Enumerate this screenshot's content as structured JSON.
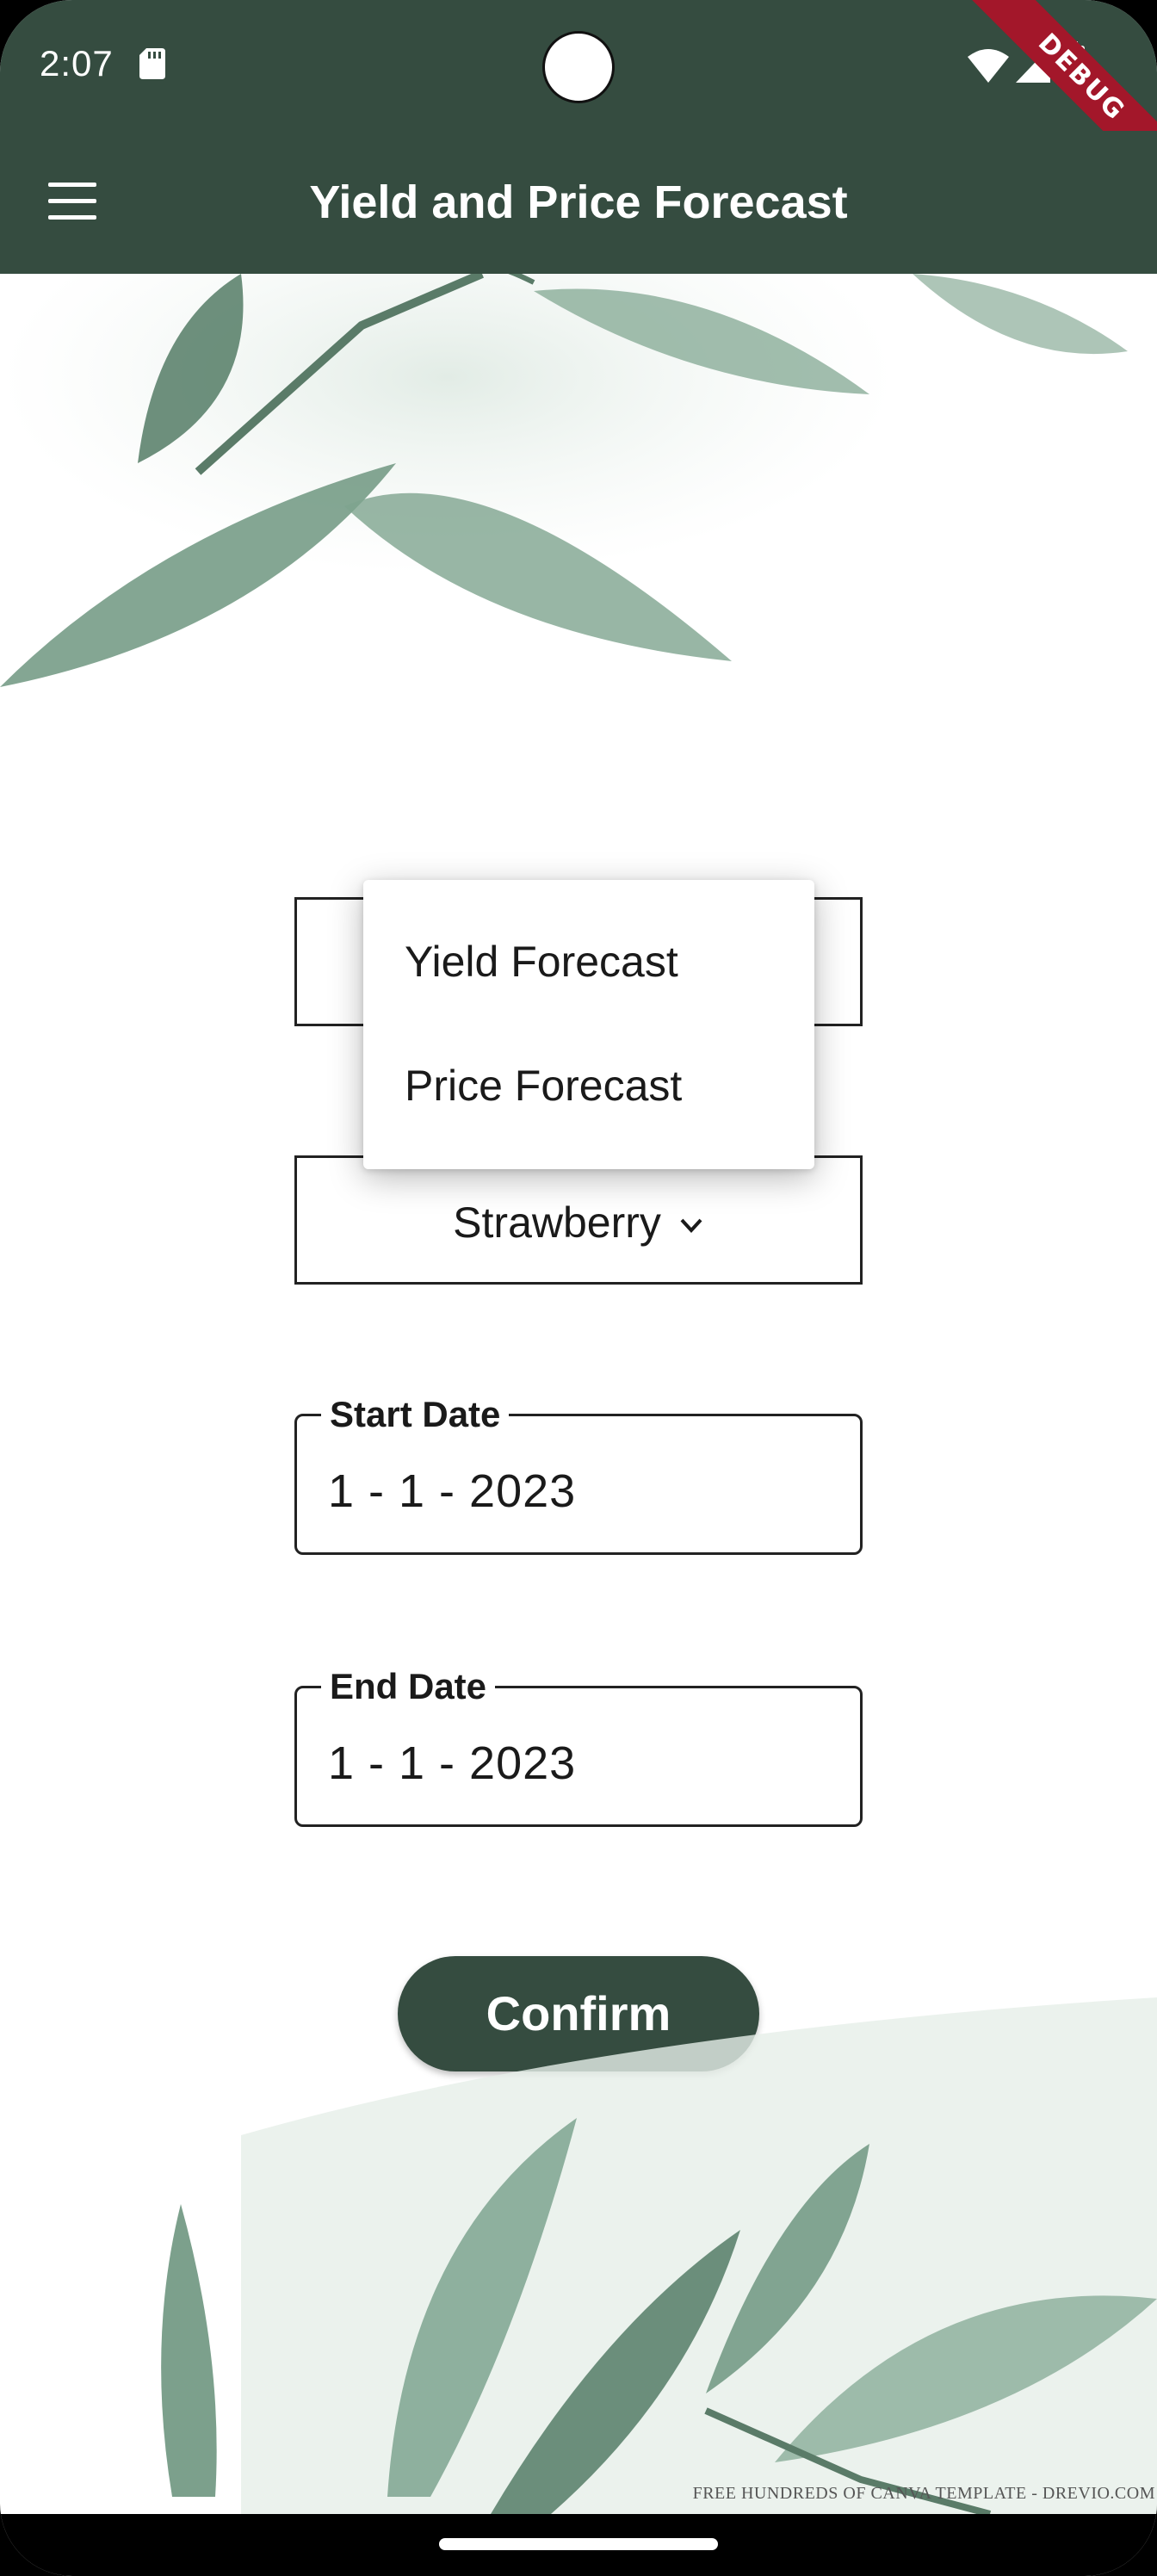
{
  "status_bar": {
    "time": "2:07",
    "debug_label": "DEBUG"
  },
  "app_bar": {
    "title": "Yield and Price Forecast"
  },
  "forecast_type_dropdown": {
    "options": [
      "Yield Forecast",
      "Price Forecast"
    ]
  },
  "crop_dropdown": {
    "selected": "Strawberry"
  },
  "start_date": {
    "label": "Start Date",
    "value": "1 - 1 - 2023"
  },
  "end_date": {
    "label": "End Date",
    "value": "1 - 1 - 2023"
  },
  "confirm_button": {
    "label": "Confirm"
  },
  "watermark": "FREE HUNDREDS OF CANVA TEMPLATE - DREVIO.COM",
  "colors": {
    "primary": "#354c40",
    "debug": "#a3172a",
    "background": "#ffffff"
  },
  "icons": [
    "menu-icon",
    "sd-card-icon",
    "wifi-icon",
    "signal-icon",
    "battery-icon",
    "chevron-down-icon"
  ]
}
